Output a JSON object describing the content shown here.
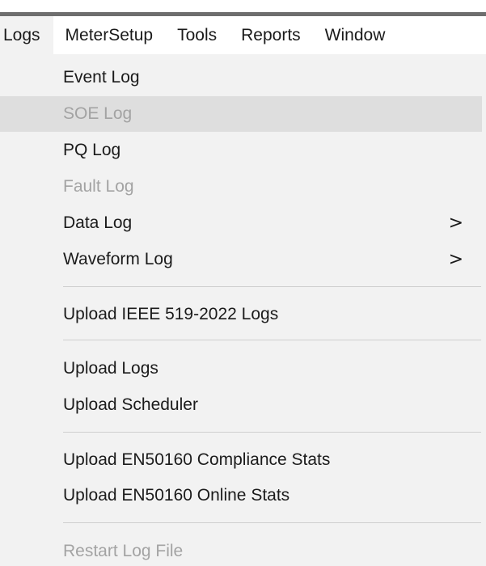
{
  "menubar": {
    "items": [
      "Logs",
      "MeterSetup",
      "Tools",
      "Reports",
      "Window"
    ]
  },
  "menu": {
    "event_log": "Event Log",
    "soe_log": "SOE Log",
    "pq_log": "PQ Log",
    "fault_log": "Fault Log",
    "data_log": "Data Log",
    "waveform_log": "Waveform Log",
    "upload_ieee": "Upload IEEE 519-2022 Logs",
    "upload_logs": "Upload Logs",
    "upload_scheduler": "Upload Scheduler",
    "upload_en50160_compliance": "Upload EN50160 Compliance Stats",
    "upload_en50160_online": "Upload EN50160 Online Stats",
    "restart_log_file": "Restart Log File",
    "submenu_arrow": ">"
  },
  "colors": {
    "menu_background": "#f2f2f2",
    "highlight": "#dedede",
    "disabled_text": "#a3a3a3",
    "text": "#1b1b1b"
  }
}
